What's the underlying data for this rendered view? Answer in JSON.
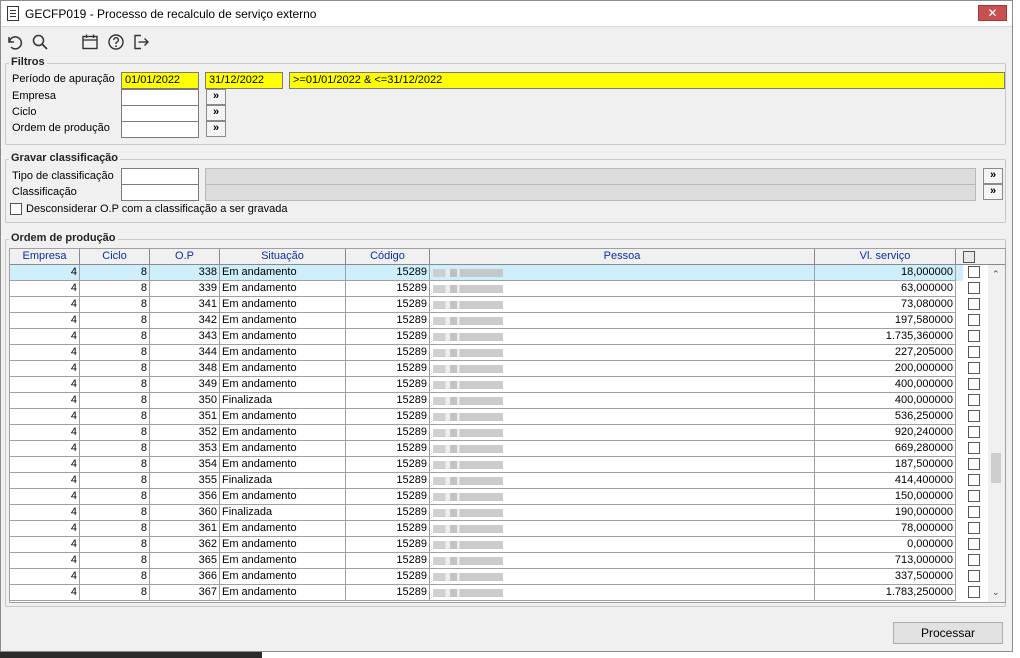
{
  "window": {
    "title": "GECFP019 - Processo de recalculo de serviço externo",
    "close_label": "✕"
  },
  "toolbar": {
    "icons": [
      "undo-icon",
      "search-icon",
      "calendar-icon",
      "help-icon",
      "exit-icon"
    ]
  },
  "filtros": {
    "legend": "Filtros",
    "periodo_label": "Período de apuração",
    "periodo_inicio": "01/01/2022",
    "periodo_fim": "31/12/2022",
    "periodo_expr": ">=01/01/2022 & <=31/12/2022",
    "empresa_label": "Empresa",
    "ciclo_label": "Ciclo",
    "ordem_label": "Ordem de produção",
    "more_label": "»"
  },
  "gravar": {
    "legend": "Gravar classificação",
    "tipo_label": "Tipo de classificação",
    "classificacao_label": "Classificação",
    "desconsiderar_label": "Desconsiderar O.P com a classificação a ser gravada",
    "more_label": "»"
  },
  "ordem": {
    "legend": "Ordem de produção",
    "columns": {
      "empresa": "Empresa",
      "ciclo": "Ciclo",
      "op": "O.P",
      "situacao": "Situação",
      "codigo": "Código",
      "pessoa": "Pessoa",
      "vl_servico": "Vl. serviço"
    },
    "rows": [
      {
        "empresa": "4",
        "ciclo": "8",
        "op": "338",
        "situacao": "Em andamento",
        "codigo": "15289",
        "vl": "18,000000"
      },
      {
        "empresa": "4",
        "ciclo": "8",
        "op": "339",
        "situacao": "Em andamento",
        "codigo": "15289",
        "vl": "63,000000"
      },
      {
        "empresa": "4",
        "ciclo": "8",
        "op": "341",
        "situacao": "Em andamento",
        "codigo": "15289",
        "vl": "73,080000"
      },
      {
        "empresa": "4",
        "ciclo": "8",
        "op": "342",
        "situacao": "Em andamento",
        "codigo": "15289",
        "vl": "197,580000"
      },
      {
        "empresa": "4",
        "ciclo": "8",
        "op": "343",
        "situacao": "Em andamento",
        "codigo": "15289",
        "vl": "1.735,360000"
      },
      {
        "empresa": "4",
        "ciclo": "8",
        "op": "344",
        "situacao": "Em andamento",
        "codigo": "15289",
        "vl": "227,205000"
      },
      {
        "empresa": "4",
        "ciclo": "8",
        "op": "348",
        "situacao": "Em andamento",
        "codigo": "15289",
        "vl": "200,000000"
      },
      {
        "empresa": "4",
        "ciclo": "8",
        "op": "349",
        "situacao": "Em andamento",
        "codigo": "15289",
        "vl": "400,000000"
      },
      {
        "empresa": "4",
        "ciclo": "8",
        "op": "350",
        "situacao": "Finalizada",
        "codigo": "15289",
        "vl": "400,000000"
      },
      {
        "empresa": "4",
        "ciclo": "8",
        "op": "351",
        "situacao": "Em andamento",
        "codigo": "15289",
        "vl": "536,250000"
      },
      {
        "empresa": "4",
        "ciclo": "8",
        "op": "352",
        "situacao": "Em andamento",
        "codigo": "15289",
        "vl": "920,240000"
      },
      {
        "empresa": "4",
        "ciclo": "8",
        "op": "353",
        "situacao": "Em andamento",
        "codigo": "15289",
        "vl": "669,280000"
      },
      {
        "empresa": "4",
        "ciclo": "8",
        "op": "354",
        "situacao": "Em andamento",
        "codigo": "15289",
        "vl": "187,500000"
      },
      {
        "empresa": "4",
        "ciclo": "8",
        "op": "355",
        "situacao": "Finalizada",
        "codigo": "15289",
        "vl": "414,400000"
      },
      {
        "empresa": "4",
        "ciclo": "8",
        "op": "356",
        "situacao": "Em andamento",
        "codigo": "15289",
        "vl": "150,000000"
      },
      {
        "empresa": "4",
        "ciclo": "8",
        "op": "360",
        "situacao": "Finalizada",
        "codigo": "15289",
        "vl": "190,000000"
      },
      {
        "empresa": "4",
        "ciclo": "8",
        "op": "361",
        "situacao": "Em andamento",
        "codigo": "15289",
        "vl": "78,000000"
      },
      {
        "empresa": "4",
        "ciclo": "8",
        "op": "362",
        "situacao": "Em andamento",
        "codigo": "15289",
        "vl": "0,000000"
      },
      {
        "empresa": "4",
        "ciclo": "8",
        "op": "365",
        "situacao": "Em andamento",
        "codigo": "15289",
        "vl": "713,000000"
      },
      {
        "empresa": "4",
        "ciclo": "8",
        "op": "366",
        "situacao": "Em andamento",
        "codigo": "15289",
        "vl": "337,500000"
      },
      {
        "empresa": "4",
        "ciclo": "8",
        "op": "367",
        "situacao": "Em andamento",
        "codigo": "15289",
        "vl": "1.783,250000"
      }
    ]
  },
  "processar_label": "Processar",
  "colors": {
    "highlight": "#ffff00",
    "header_text": "#0b2fa0",
    "selected_row": "#cdeefa",
    "close": "#c75050"
  }
}
